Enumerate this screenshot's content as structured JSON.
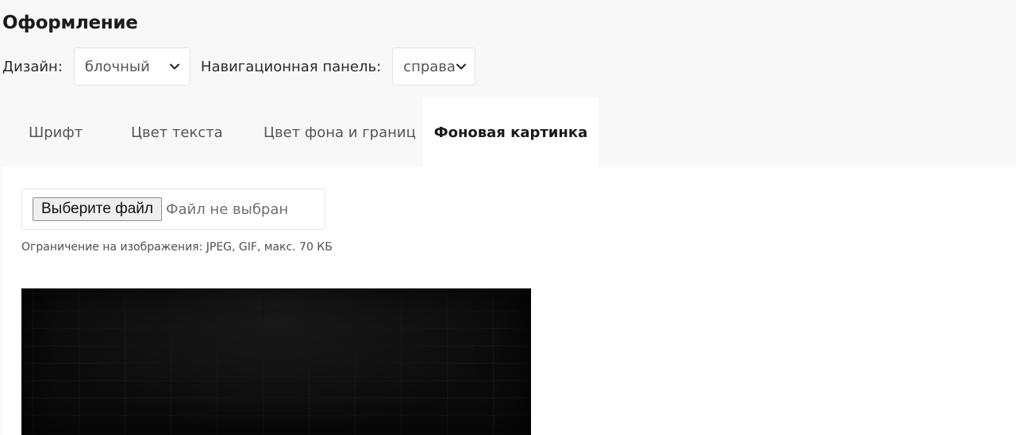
{
  "page": {
    "title": "Оформление"
  },
  "controls": {
    "design_label": "Дизайн:",
    "design_value": "блочный",
    "nav_label": "Навигационная панель:",
    "nav_value": "справа"
  },
  "tabs": [
    {
      "label": "Шрифт",
      "active": false
    },
    {
      "label": "Цвет текста",
      "active": false
    },
    {
      "label": "Цвет фона и границ",
      "active": false
    },
    {
      "label": "Фоновая картинка",
      "active": true
    }
  ],
  "upload": {
    "button_label": "Выберите файл",
    "status": "Файл не выбран",
    "hint": "Ограничение на изображения: JPEG, GIF, макс. 70 КБ"
  },
  "icons": {
    "dropdown": "chevron-down-icon"
  },
  "colors": {
    "page_background": "#f8f8f8",
    "panel_background": "#ffffff",
    "preview_background": "#0d0d0d"
  }
}
